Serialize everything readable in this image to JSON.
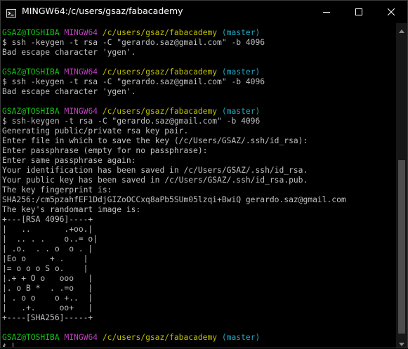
{
  "window": {
    "title": "MINGW64:/c/users/gsaz/fabacademy"
  },
  "prompt": {
    "user": "GSAZ@TOSHIBA",
    "host": "MINGW64",
    "path": "/c/users/gsaz/fabacademy",
    "branch": "(master)"
  },
  "terminal": {
    "commands": [
      "$ ssh -keygen -t rsa -C \"gerardo.saz@gmail.com\" -b 4096",
      "$ ssh -keygen -t rsa -C \"gerardo.saz@gmail.com\" -b 4096",
      "$ ssh-keygen -t rsa -C \"gerardo.saz@gmail.com\" -b 4096"
    ],
    "errors": [
      "Bad escape character 'ygen'.",
      "Bad escape character 'ygen'."
    ],
    "output": [
      "Generating public/private rsa key pair.",
      "Enter file in which to save the key (/c/Users/GSAZ/.ssh/id_rsa):",
      "Enter passphrase (empty for no passphrase):",
      "Enter same passphrase again:",
      "Your identification has been saved in /c/Users/GSAZ/.ssh/id_rsa.",
      "Your public key has been saved in /c/Users/GSAZ/.ssh/id_rsa.pub.",
      "The key fingerprint is:",
      "SHA256:/cm5pzahfEF1DdjGIZoOCCxq8aPb5SUm05lzqi+BwiQ gerardo.saz@gmail.com",
      "The key's randomart image is:",
      "+---[RSA 4096]----+",
      "|   ..       .+oo.|",
      "|  .. . .    o..= o|",
      "| .o.  . . o  o . |",
      "|Eo o     + .    |",
      "|= o o o S o.    |",
      "|.+ + O o   ooo   |",
      "|. o B *  . .=o   |",
      "| . o o    o +..  |",
      "|   .+.     oo+   |",
      "+----[SHA256]-----+"
    ],
    "final_prompt": "$"
  },
  "icons": {
    "app": "git-bash-icon",
    "minimize": "minimize-icon",
    "maximize": "maximize-icon",
    "close": "close-icon"
  },
  "colors": {
    "background": "#000000",
    "text": "#c0c0c0",
    "user": "#12c413",
    "host": "#bf3fbf",
    "path": "#bfbf00",
    "branch": "#1fa7bf"
  }
}
